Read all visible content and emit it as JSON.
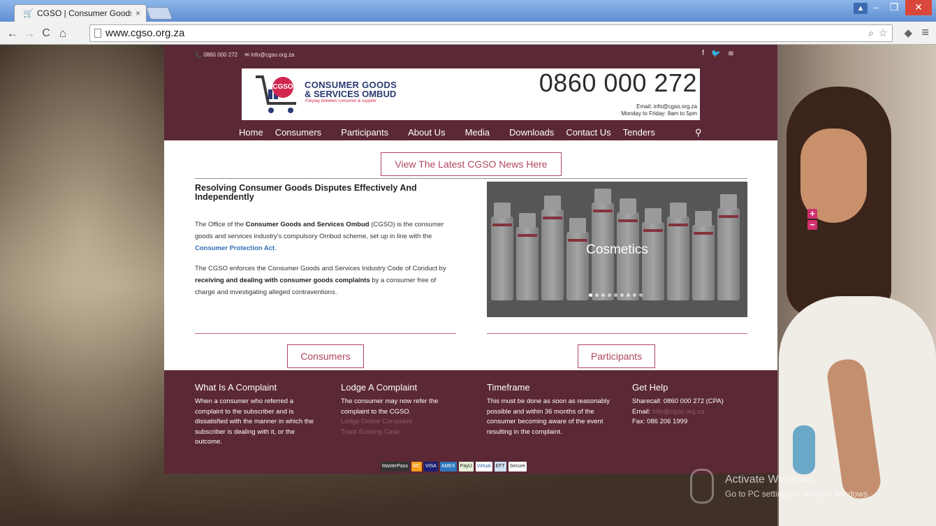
{
  "browser": {
    "tab_title": "CGSO | Consumer Goods",
    "tab_close": "×",
    "url": "www.cgso.org.za"
  },
  "site": {
    "topbar": {
      "phone": "0860 000 272",
      "email": "info@cgso.org.za"
    },
    "logo": {
      "badge": "CGSO",
      "line1": "CONSUMER GOODS",
      "line2": "& SERVICES OMBUD",
      "tagline": "Fairplay between consumer & supplier"
    },
    "header_phone": "0860 000 272",
    "header_email": "Email: info@cgso.org.za",
    "header_hours": "Monday to Friday: 8am to 5pm",
    "nav": [
      "Home",
      "Consumers",
      "Participants",
      "About Us",
      "Media",
      "Downloads",
      "Contact Us",
      "Tenders"
    ],
    "news_button": "View The Latest CGSO News Here",
    "intro_heading": "Resolving Consumer Goods Disputes Effectively And Independently",
    "intro_p1": {
      "a": "The Office of the ",
      "b": "Consumer Goods and Services Ombud",
      "c": " (CGSO) is the consumer goods and services industry's compulsory Ombud scheme, set up in line with the ",
      "link": "Consumer Protection Act",
      "d": "."
    },
    "intro_p2": {
      "a": "The CGSO enforces the Consumer Goods and Services Industry Code of Conduct by ",
      "b": "receiving and dealing with consumer goods complaints",
      "c": " by a consumer free of charge and investigating alleged contraventions."
    },
    "slider_caption": "Cosmetics",
    "consumers_button": "Consumers",
    "participants_button": "Participants",
    "footer": {
      "c1_title": "What Is A Complaint",
      "c1_text": "When a consumer who referred a complaint to the subscriber and is dissatisfied with the manner in which the subscriber is dealing with it, or the outcome.",
      "c2_title": "Lodge A Complaint",
      "c2_text": "The consumer may now refer the complaint to the CGSO.",
      "c2_link1": "Lodge Online Complaint",
      "c2_link2": "Track Existing Case",
      "c3_title": "Timeframe",
      "c3_text": "This must be done as soon as reasonably possible and within 36 months of the consumer becoming aware of the event resulting in the complaint.",
      "c4_title": "Get Help",
      "c4_sharecall": "Sharecall: 0860 000 272 (CPA)",
      "c4_email_label": "Email: ",
      "c4_email": "info@cgso.org.za",
      "c4_fax": "Fax: 086 206 1999"
    },
    "payments": [
      "MasterPass",
      "MC",
      "VISA",
      "AMEX",
      "PayU",
      "Virtual",
      "EFT",
      "Secure"
    ]
  },
  "overlay": {
    "activate_title": "Activate Windows",
    "activate_sub": "Go to PC settings to activate Windows."
  },
  "colors": {
    "brand_maroon": "#5b2835",
    "accent_pink": "#b04760",
    "link_blue": "#2f6fb3"
  }
}
